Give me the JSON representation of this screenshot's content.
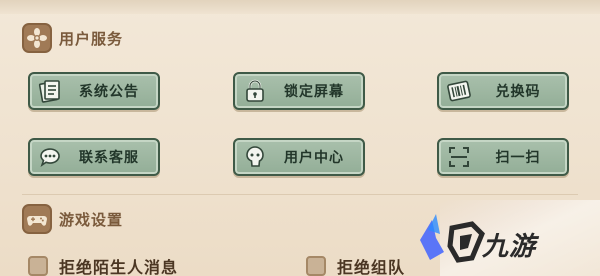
{
  "sections": {
    "user_services": {
      "title": "用户服务"
    },
    "game_settings": {
      "title": "游戏设置"
    }
  },
  "buttons": [
    {
      "label": "系统公告",
      "icon": "notice-scroll-icon"
    },
    {
      "label": "锁定屏幕",
      "icon": "lock-icon"
    },
    {
      "label": "兑换码",
      "icon": "barcode-icon"
    },
    {
      "label": "联系客服",
      "icon": "chat-bubble-icon"
    },
    {
      "label": "用户中心",
      "icon": "user-head-icon"
    },
    {
      "label": "扫一扫",
      "icon": "scan-icon"
    }
  ],
  "settings": [
    {
      "label": "拒绝陌生人消息",
      "checked": false
    },
    {
      "label": "拒绝组队",
      "checked": false
    }
  ],
  "watermark": {
    "text": "九游",
    "logo": "jiuyou-logo"
  },
  "colors": {
    "panel_bg": "#efe3d1",
    "button_fill": "#9fb8a2",
    "button_border": "#3f5a47",
    "section_icon_bg": "#a07a56",
    "title_text": "#7a5a3c"
  }
}
